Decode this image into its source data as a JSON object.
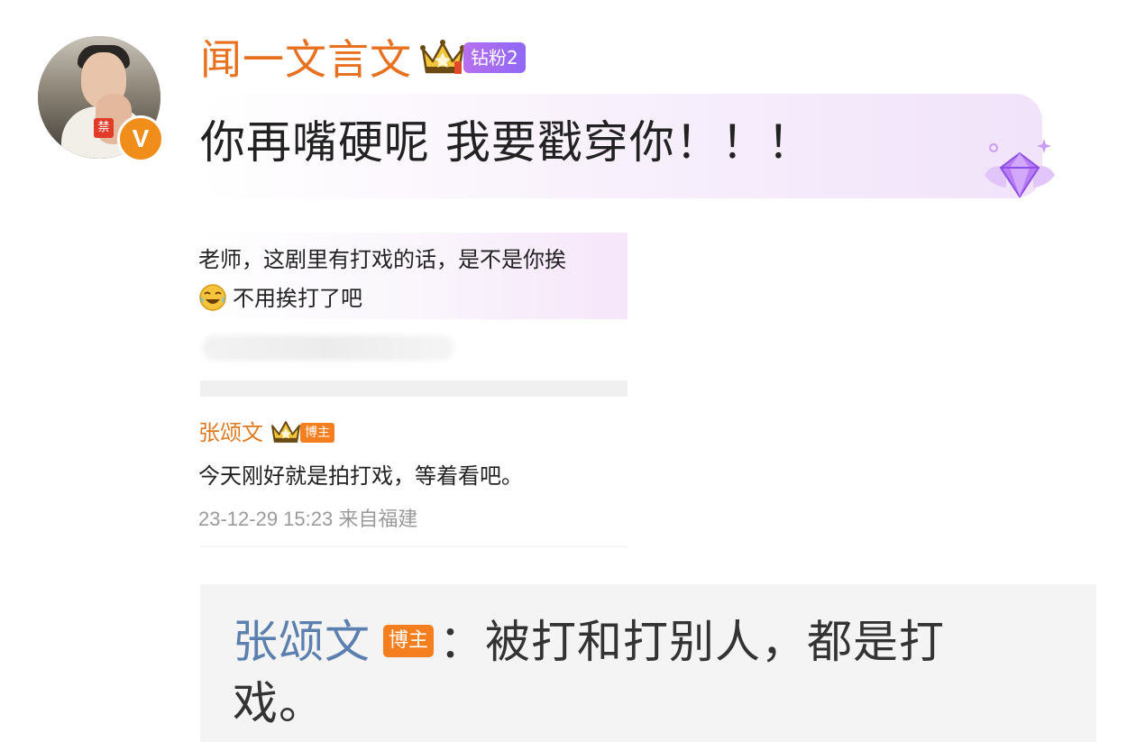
{
  "post": {
    "username": "闻一文言文",
    "fan_badge": "钻粉2",
    "ban_label": "禁",
    "verified_mark": "V",
    "bubble_text": "你再嘴硬呢 我要戳穿你！！！",
    "icons": [
      "avatar",
      "verified-icon",
      "crown-icon",
      "diamond-gem-icon"
    ]
  },
  "screenshot": {
    "comment_line1": "老师，这剧里有打戏的话，是不是你挨",
    "comment_line2": "不用挨打了吧",
    "reply": {
      "author": "张颂文",
      "badge": "博主",
      "text": "今天刚好就是拍打戏，等着看吧。",
      "meta": "23-12-29 15:23  来自福建"
    }
  },
  "reply_box": {
    "author": "张颂文",
    "badge": "博主",
    "text": "：被打和打别人，都是打戏。"
  },
  "colors": {
    "username": "#e8711f",
    "reply_author": "#5b7fae",
    "badge_orange": "#f57e1f",
    "fan_badge_purple": "#9b6cf3"
  }
}
